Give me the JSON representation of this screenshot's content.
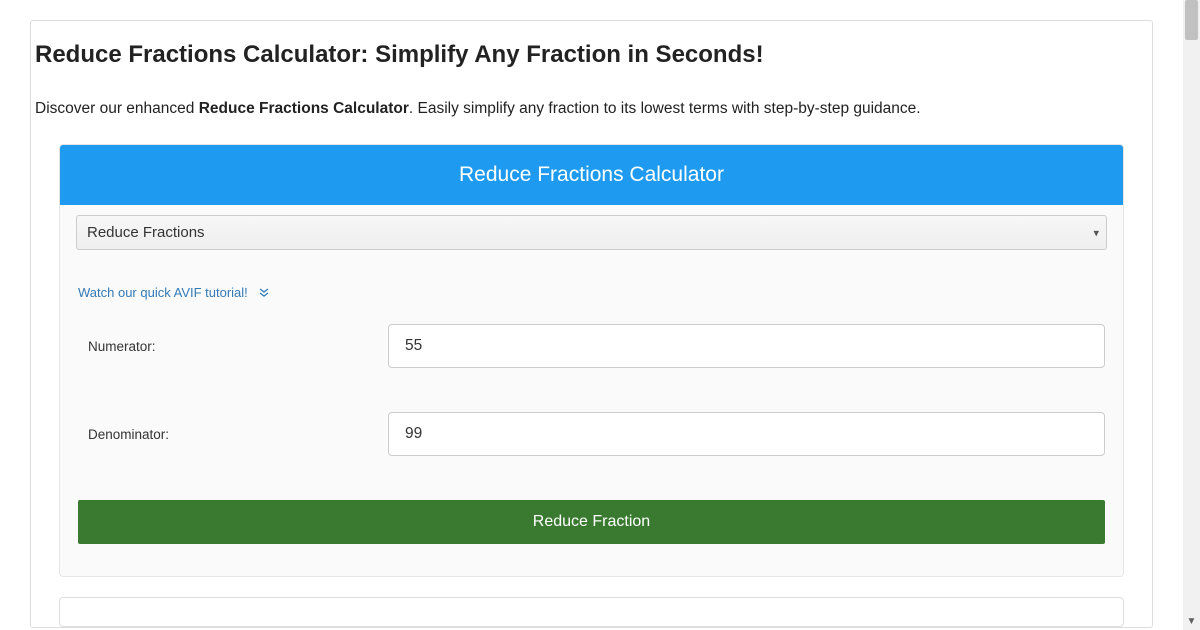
{
  "page": {
    "title": "Reduce Fractions Calculator: Simplify Any Fraction in Seconds!",
    "intro_prefix": "Discover our enhanced ",
    "intro_bold": "Reduce Fractions Calculator",
    "intro_suffix": ". Easily simplify any fraction to its lowest terms with step-by-step guidance."
  },
  "calculator": {
    "header": "Reduce Fractions Calculator",
    "mode_selected": "Reduce Fractions",
    "tutorial_link": "Watch our quick AVIF tutorial!",
    "numerator_label": "Numerator:",
    "numerator_value": "55",
    "denominator_label": "Denominator:",
    "denominator_value": "99",
    "submit_label": "Reduce Fraction"
  },
  "colors": {
    "header_bg": "#1e9bf0",
    "submit_bg": "#3a7a30",
    "link": "#337ab7"
  }
}
